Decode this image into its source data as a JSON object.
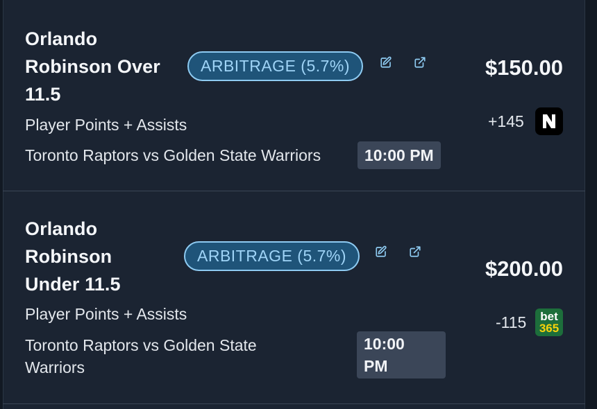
{
  "bets": [
    {
      "title_lines": [
        "Orlando",
        "Robinson Over",
        "11.5"
      ],
      "badge": "ARBITRAGE (5.7%)",
      "market": "Player Points + Assists",
      "matchup": "Toronto Raptors vs Golden State Warriors",
      "time": "10:00 PM",
      "amount": "$150.00",
      "odds": "+145",
      "sportsbook_icon": "novig-logo-icon"
    },
    {
      "title_lines": [
        "Orlando",
        "Robinson",
        "Under 11.5"
      ],
      "badge": "ARBITRAGE (5.7%)",
      "market": "Player Points + Assists",
      "matchup_lines": [
        "Toronto Raptors vs Golden State",
        "Warriors"
      ],
      "time_lines": [
        "10:00",
        "PM"
      ],
      "amount": "$200.00",
      "odds": "-115",
      "sportsbook_logo": {
        "line1": "bet",
        "line2": "365"
      }
    }
  ],
  "colors": {
    "background": "#121923",
    "card": "#1b2432",
    "badge_border": "#8ecbf2",
    "badge_fill": "#1f5479",
    "time_badge": "#3b4658"
  }
}
